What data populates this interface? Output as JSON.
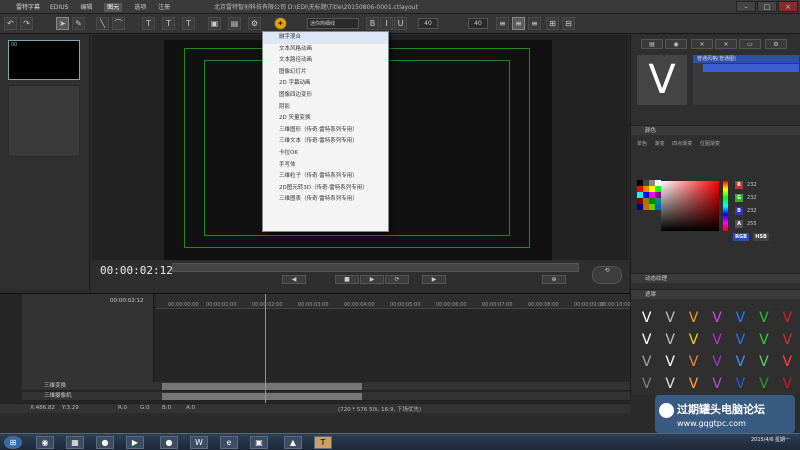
{
  "titlebar": {
    "app_name": "雷特字幕",
    "menus": [
      "EDIUS",
      "编辑",
      "图元",
      "选项",
      "注册"
    ],
    "active_menu_index": 2,
    "path": "北京雷特智创科技有限公司 D:\\EDI\\无标题\\Title\\20150806-0001.ctlayout"
  },
  "toolbar": {
    "font_name": "迷你简细线",
    "font_size": "40",
    "char_size": "40",
    "highlight_color": "#e6a100"
  },
  "thumbnail": {
    "label": "00"
  },
  "dropdown": {
    "items": [
      "融字混合",
      "文本风格动画",
      "文本路径动画",
      "图像幻灯片",
      "2D 字幕动画",
      "图像四边变形",
      "阴影",
      "2D 矢量变换",
      "三维图形（传奇·雷特系列专用）",
      "三维文本（传奇·雷特系列专用）",
      "卡拉OK",
      "手写体",
      "三维粒子（传奇·雷特系列专用）",
      "2D图元转3D（传奇·雷特系列专用）",
      "三维图表（传奇·雷特系列专用）"
    ]
  },
  "transport": {
    "timecode": "00:00:02:12"
  },
  "right_panel": {
    "layer_name": "普通风格(普通图)",
    "big_letter": "V",
    "section_color": "颜色",
    "subtabs": [
      "单色",
      "渐变",
      "四点渐变",
      "位图渐变"
    ],
    "rgb": {
      "r": "232",
      "g": "232",
      "b": "232",
      "a": "255"
    },
    "mode_button": "RGB",
    "mode_button2": "HSB",
    "section_effect": "动态纹理",
    "section_mask": "遮罩",
    "v_colors": [
      "#ffffff",
      "#bbbbbb",
      "#e8a020",
      "#e040e0",
      "#2080ff",
      "#20c040",
      "#e02020",
      "#ffffff",
      "#c0c0c0",
      "#f0d020",
      "#c030c0",
      "#3070f0",
      "#30d030",
      "#d03030",
      "#a0a0a0",
      "#ffffff",
      "#f08030",
      "#9040c0",
      "#4090ff",
      "#60d060",
      "#ff4040",
      "#808080",
      "#e0e0e0",
      "#ffa040",
      "#b050d0",
      "#2060e0",
      "#20a020",
      "#c02020"
    ]
  },
  "timeline": {
    "ruler": [
      "00:00:00:00",
      "00:00:01:00",
      "00:00:02:00",
      "00:00:03:00",
      "00:00:04:00",
      "00:00:05:00",
      "00:00:06:00",
      "00:00:07:00",
      "00:00:08:00",
      "00:00:09:00",
      "00:00:10:00"
    ],
    "header_time": "00:00:02:12",
    "tracks": [
      "三维变换",
      "三维摄像机"
    ]
  },
  "statusbar": {
    "x": "X:486.82",
    "y": "Y:3.29",
    "r": "R:0",
    "g": "G:0",
    "b": "B:0",
    "a": "A:0",
    "info": "(720 * 576 50i, 16:9, 下场优先)"
  },
  "taskbar": {
    "time": "2015/4/6 星期一"
  },
  "watermark": {
    "title": "过期罐头电脑论坛",
    "url": "www.gqgtpc.com"
  }
}
